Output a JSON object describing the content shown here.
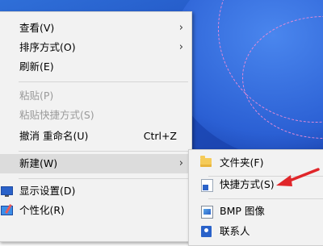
{
  "context_menu": {
    "items": [
      {
        "label": "查看(V)",
        "has_submenu": true,
        "enabled": true
      },
      {
        "label": "排序方式(O)",
        "has_submenu": true,
        "enabled": true
      },
      {
        "label": "刷新(E)",
        "has_submenu": false,
        "enabled": true
      },
      {
        "label": "粘贴(P)",
        "has_submenu": false,
        "enabled": false
      },
      {
        "label": "粘贴快捷方式(S)",
        "has_submenu": false,
        "enabled": false
      },
      {
        "label": "撤消 重命名(U)",
        "shortcut": "Ctrl+Z",
        "has_submenu": false,
        "enabled": true
      },
      {
        "label": "新建(W)",
        "has_submenu": true,
        "enabled": true,
        "highlighted": true
      },
      {
        "label": "显示设置(D)",
        "icon": "display-icon",
        "has_submenu": false,
        "enabled": true
      },
      {
        "label": "个性化(R)",
        "icon": "personalize-icon",
        "has_submenu": false,
        "enabled": true
      }
    ],
    "arrow_glyph": "›"
  },
  "new_submenu": {
    "items": [
      {
        "label": "文件夹(F)",
        "icon": "folder-icon"
      },
      {
        "label": "快捷方式(S)",
        "icon": "shortcut-icon"
      },
      {
        "label": "BMP 图像",
        "icon": "bmp-icon"
      },
      {
        "label": "联系人",
        "icon": "contact-icon"
      }
    ]
  },
  "colors": {
    "menu_background": "#f2f2f2",
    "highlight": "#dcdcdc",
    "disabled_text": "#9a9a9a",
    "annotation_arrow": "#e0262a",
    "desktop_blue": "#1f4fc0"
  }
}
